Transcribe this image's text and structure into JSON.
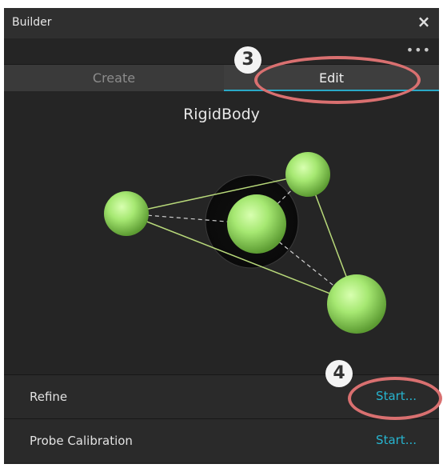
{
  "window": {
    "title": "Builder",
    "close_glyph": "×"
  },
  "toolbar": {
    "more_glyph": "•••"
  },
  "tabs": [
    {
      "label": "Create",
      "active": false
    },
    {
      "label": "Edit",
      "active": true
    }
  ],
  "viewport": {
    "asset_name": "RigidBody",
    "marker_color": "#9be06a"
  },
  "rows": [
    {
      "label": "Refine",
      "action": "Start..."
    },
    {
      "label": "Probe Calibration",
      "action": "Start..."
    }
  ],
  "callouts": [
    {
      "number": "3",
      "target": "tab-edit"
    },
    {
      "number": "4",
      "target": "refine-start"
    }
  ],
  "colors": {
    "accent": "#27b4cf",
    "highlight": "#d97070",
    "panel": "#252525"
  }
}
